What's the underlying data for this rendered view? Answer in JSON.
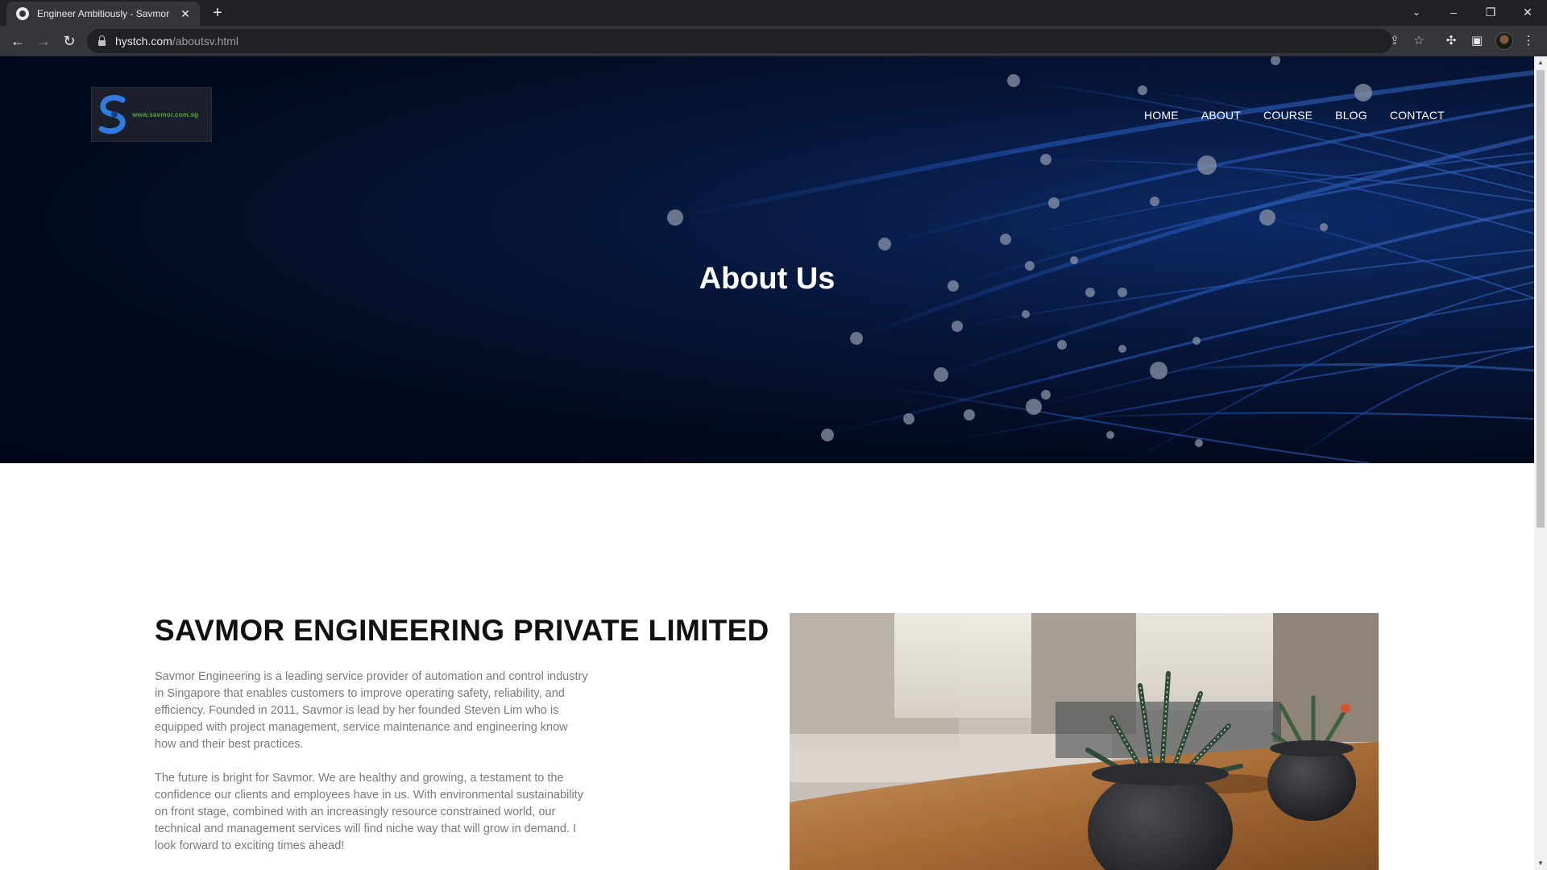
{
  "browser": {
    "tab_title": "Engineer Ambitiously - Savmor",
    "url_host": "hystch.com",
    "url_path": "/aboutsv.html"
  },
  "header": {
    "logo_text": "www.savmor.com.sg",
    "nav": [
      "HOME",
      "ABOUT",
      "COURSE",
      "BLOG",
      "CONTACT"
    ]
  },
  "hero": {
    "title": "About Us"
  },
  "about": {
    "company_name": "SAVMOR ENGINEERING PRIVATE LIMITED",
    "paragraph1": "Savmor Engineering is a leading service provider of automation and control industry in Singapore that enables customers to improve operating safety, reliability, and efficiency. Founded in 2011, Savmor is lead by her founded Steven Lim who is equipped with project management, service maintenance and engineering know how and their best practices.",
    "paragraph2": "The future is bright for Savmor. We are healthy and growing, a testament to the confidence our clients and employees have in us. With environmental sustainability on front stage, combined with an increasingly resource constrained world, our technical and management services will find niche way that will grow in demand. I look forward to exciting times ahead!"
  },
  "colors": {
    "hero_bg": "#020a1f",
    "fiber_blue": "#1e4fa8",
    "body_text": "#7a7a7a",
    "heading": "#111111"
  }
}
